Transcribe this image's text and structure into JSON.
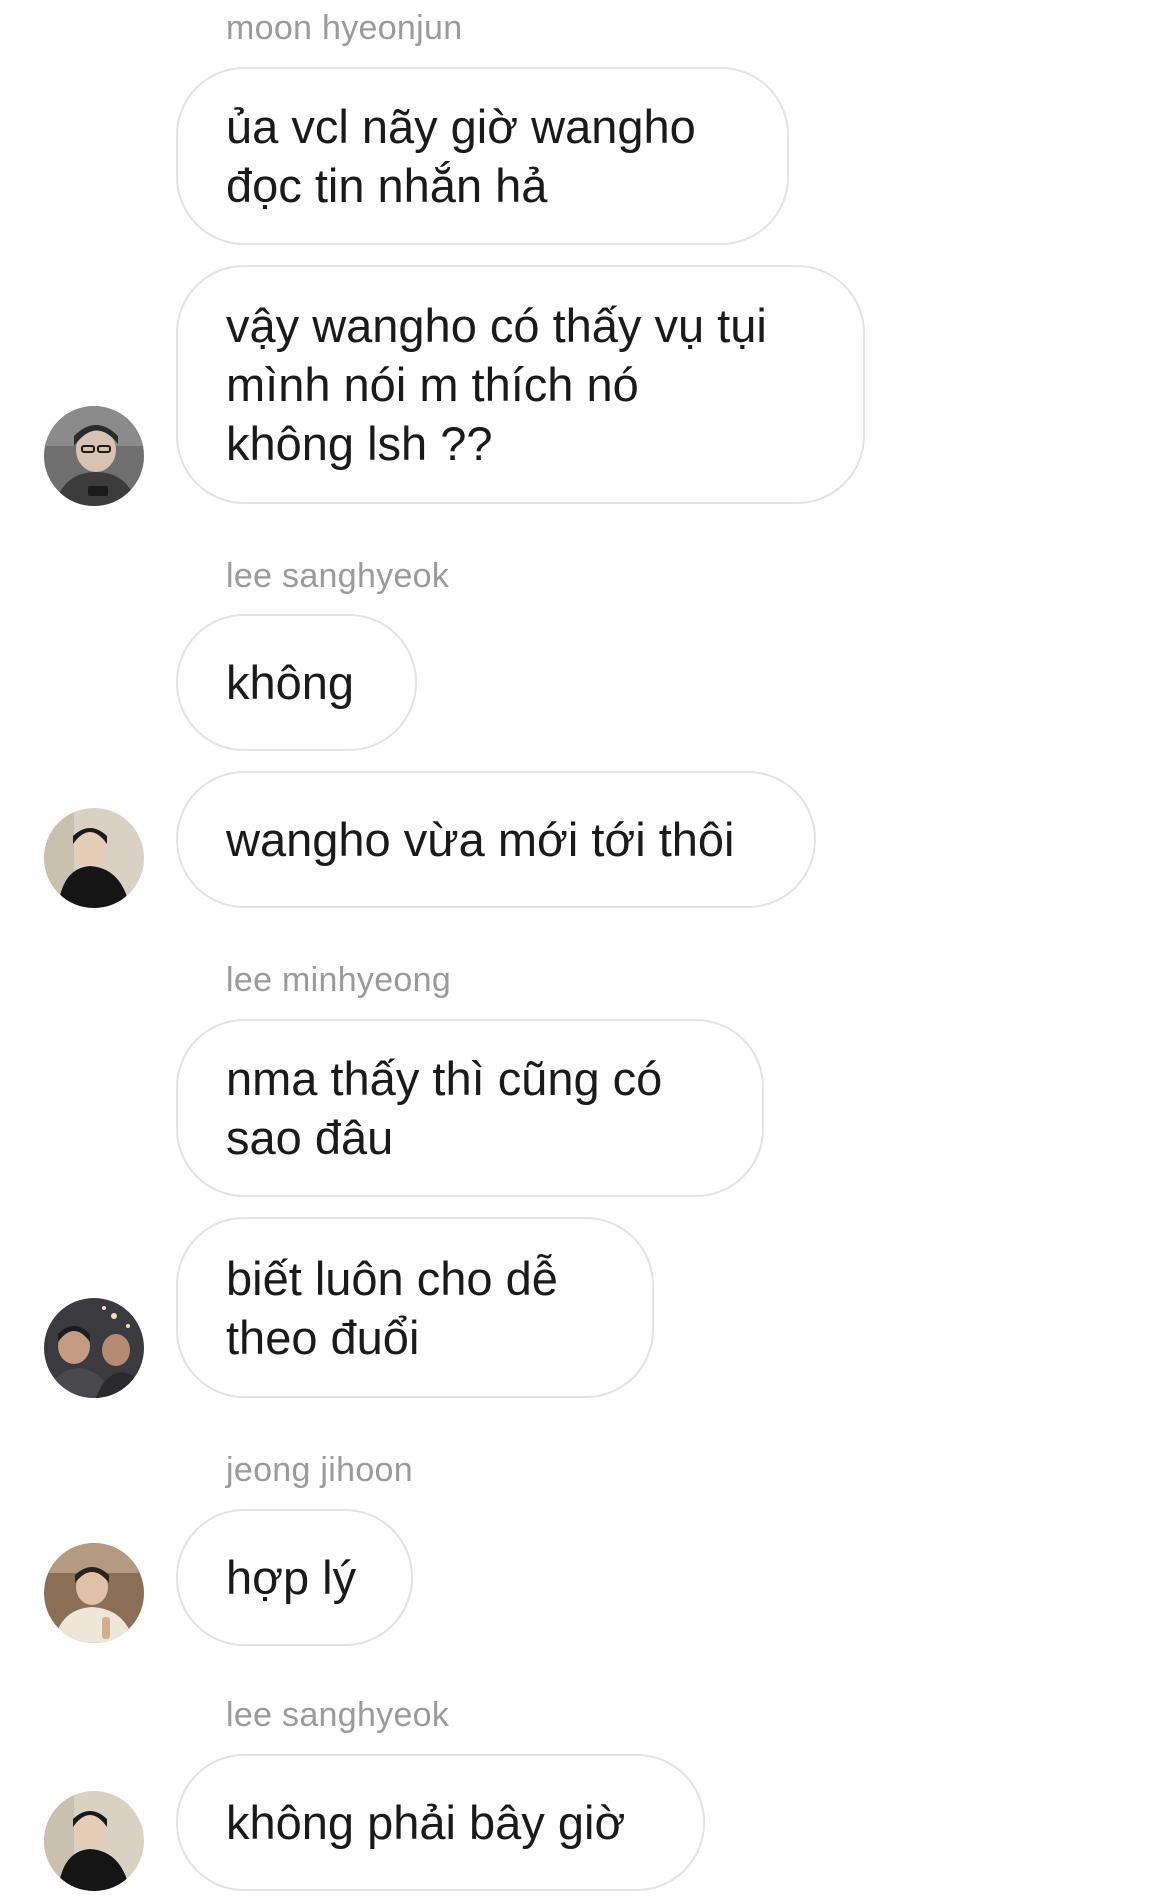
{
  "messages": [
    {
      "sender": "moon hyeonjun",
      "bubbles": [
        "ủa vcl nãy giờ wangho\nđọc tin nhắn hả",
        "vậy wangho có thấy vụ tụi\nmình nói m thích nó\nkhông lsh ??"
      ]
    },
    {
      "sender": "lee sanghyeok",
      "bubbles": [
        "không",
        "wangho vừa mới tới thôi"
      ]
    },
    {
      "sender": "lee minhyeong",
      "bubbles": [
        "nma thấy thì cũng có\nsao đâu",
        "biết luôn cho dễ\ntheo đuổi"
      ]
    },
    {
      "sender": "jeong jihoon",
      "bubbles": [
        "hợp lý"
      ]
    },
    {
      "sender": "lee sanghyeok",
      "bubbles": [
        "không phải bây giờ"
      ]
    }
  ],
  "avatars": [
    {
      "icon": "user-photo-avatar-moon-hyeonjun",
      "bg": "#6f6f6f",
      "fg": "#2a2a2a"
    },
    {
      "icon": "user-photo-avatar-lee-sanghyeok",
      "bg": "#d9d2c4",
      "fg": "#151515"
    },
    {
      "icon": "user-photo-avatar-lee-minhyeong",
      "bg": "#3b3a3f",
      "fg": "#1c1b1e"
    },
    {
      "icon": "user-photo-avatar-jeong-jihoon",
      "bg": "#8a6e56",
      "fg": "#2b211c"
    },
    {
      "icon": "user-photo-avatar-lee-sanghyeok",
      "bg": "#d9d2c4",
      "fg": "#151515"
    }
  ],
  "colors": {
    "bubble_border": "#e3e3e3",
    "sender_text": "#9a9a9a",
    "message_text": "#1a1a1a",
    "background": "#ffffff"
  }
}
